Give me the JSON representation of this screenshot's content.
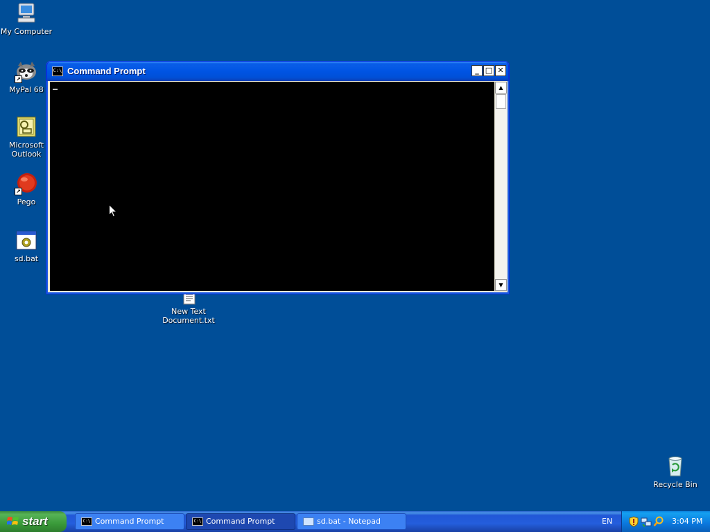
{
  "desktop": {
    "icons": [
      {
        "label": "My Computer",
        "icon": "my-computer-icon"
      },
      {
        "label": "MyPal 68",
        "icon": "mypal-browser-icon"
      },
      {
        "label": "Microsoft\nOutlook",
        "icon": "outlook-icon"
      },
      {
        "label": "Pego",
        "icon": "pego-icon"
      },
      {
        "label": "sd.bat",
        "icon": "batch-file-icon"
      },
      {
        "label": "New Text\nDocument.txt",
        "icon": "text-document-icon"
      },
      {
        "label": "Recycle Bin",
        "icon": "recycle-bin-icon"
      }
    ],
    "background_color": "#004e98"
  },
  "window": {
    "title": "Command Prompt",
    "icon_glyph": "C:\\",
    "minimize_glyph": "_",
    "maximize_glyph": "□",
    "close_glyph": "✕",
    "scroll_up_glyph": "▲",
    "scroll_down_glyph": "▼",
    "console_background": "#000000"
  },
  "taskbar": {
    "start_label": "start",
    "items": [
      {
        "label": "Command Prompt",
        "icon": "cmd-icon",
        "active": false
      },
      {
        "label": "Command Prompt",
        "icon": "cmd-icon",
        "active": true
      },
      {
        "label": "sd.bat - Notepad",
        "icon": "notepad-icon",
        "active": false
      }
    ],
    "task_icon_glyph": "C:\\",
    "language": "EN",
    "tray_icons": [
      "security-shield-icon",
      "network-icon",
      "search-icon"
    ],
    "clock": "3:04 PM"
  }
}
